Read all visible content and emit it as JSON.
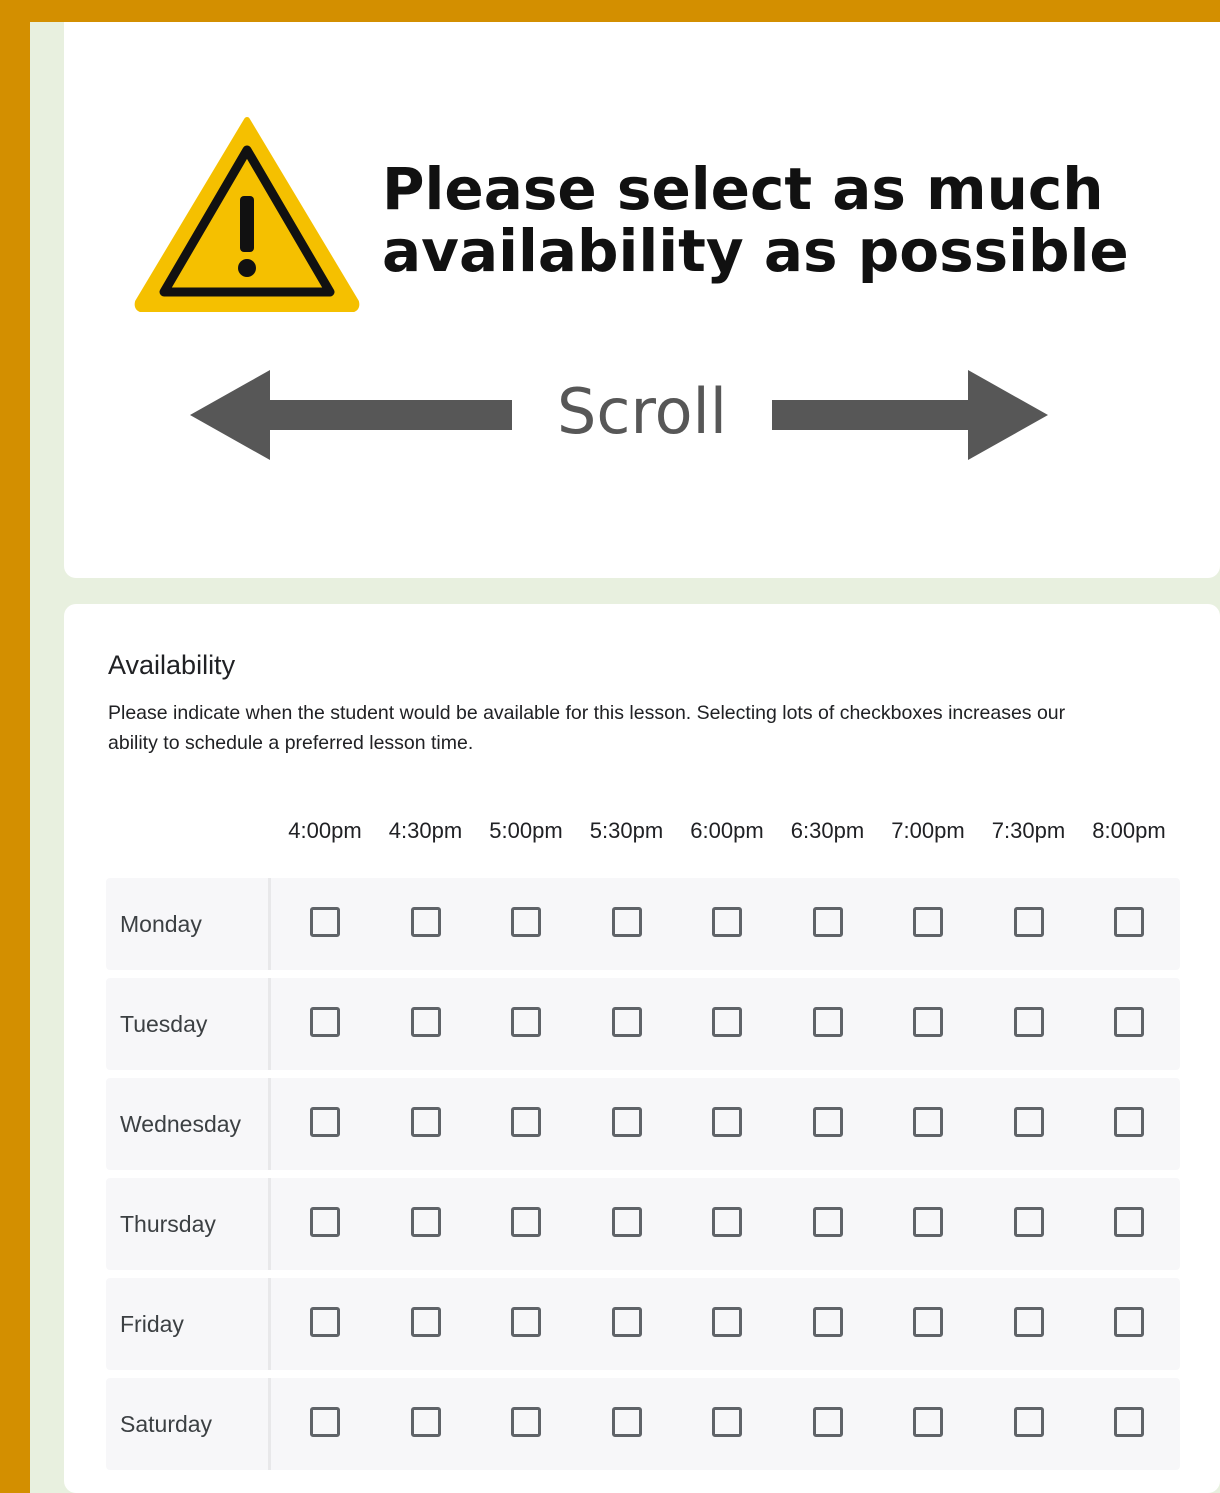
{
  "banner": {
    "warning_line1": "Please select as much",
    "warning_line2": "availability as possible",
    "scroll_label": "Scroll"
  },
  "question": {
    "title": "Availability",
    "description": "Please indicate when the student would be available for this lesson. Selecting lots of checkboxes increases our ability to schedule a preferred lesson time."
  },
  "grid": {
    "columns": [
      "4:00pm",
      "4:30pm",
      "5:00pm",
      "5:30pm",
      "6:00pm",
      "6:30pm",
      "7:00pm",
      "7:30pm",
      "8:00pm"
    ],
    "rows": [
      "Monday",
      "Tuesday",
      "Wednesday",
      "Thursday",
      "Friday",
      "Saturday"
    ],
    "checked": []
  },
  "colors": {
    "frame": "#d38f00",
    "page_background": "#e8f0df",
    "warning_yellow": "#f5c000",
    "arrow_gray": "#575757",
    "checkbox_border": "#5f6368"
  },
  "icons": {
    "warning": "warning-triangle-icon",
    "left_arrow": "arrow-left-icon",
    "right_arrow": "arrow-right-icon"
  }
}
